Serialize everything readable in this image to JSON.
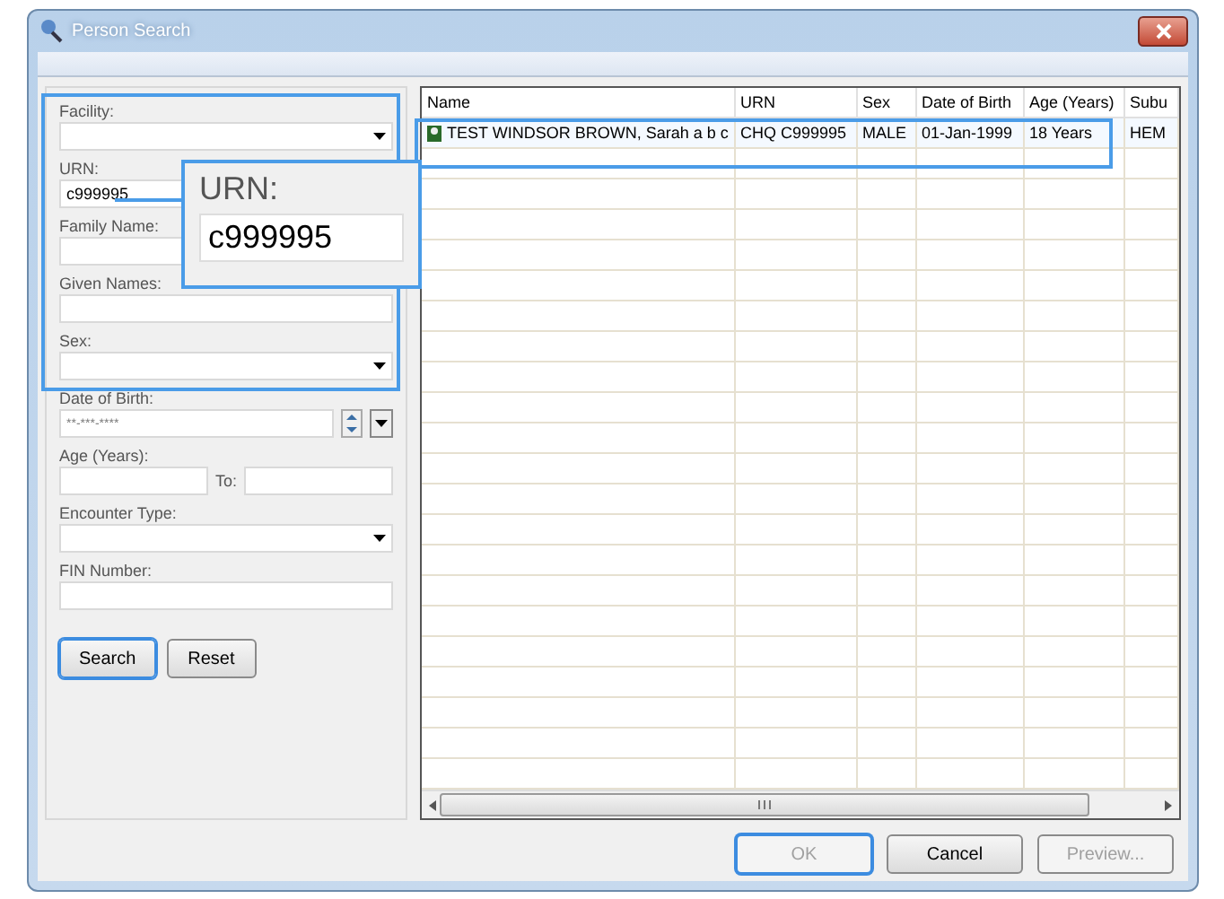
{
  "window": {
    "title": "Person Search"
  },
  "form": {
    "fields": [
      {
        "kind": "dropdown",
        "label": "Facility:"
      },
      {
        "kind": "text",
        "label": "URN:",
        "value": "c999995"
      },
      {
        "kind": "text",
        "label": "Family Name:"
      },
      {
        "kind": "text",
        "label": "Given Names:"
      },
      {
        "kind": "dropdown",
        "label": "Sex:"
      },
      {
        "kind": "date",
        "label": "Date of Birth:",
        "placeholder": "**-***-****"
      },
      {
        "kind": "range",
        "label": "Age (Years):",
        "to_label": "To:"
      },
      {
        "kind": "dropdown",
        "label": "Encounter Type:"
      },
      {
        "kind": "text",
        "label": "FIN Number:"
      }
    ],
    "buttons": [
      {
        "label": "Search",
        "focused": true
      },
      {
        "label": "Reset",
        "focused": false
      }
    ]
  },
  "table": {
    "columns": [
      "Name",
      "URN",
      "Sex",
      "Date of Birth",
      "Age (Years)",
      "Subu"
    ],
    "rows": [
      {
        "cells": [
          "TEST WINDSOR BROWN, Sarah a b c",
          "CHQ C999995",
          "MALE",
          "01-Jan-1999",
          "18 Years",
          "HEM"
        ],
        "selected": true
      }
    ]
  },
  "callout": {
    "label": "URN:",
    "value": "c999995"
  },
  "footer": {
    "buttons": [
      {
        "label": "OK",
        "disabled": true,
        "focused": true
      },
      {
        "label": "Cancel",
        "disabled": false,
        "focused": false
      },
      {
        "label": "Preview...",
        "disabled": true,
        "focused": false
      }
    ]
  }
}
